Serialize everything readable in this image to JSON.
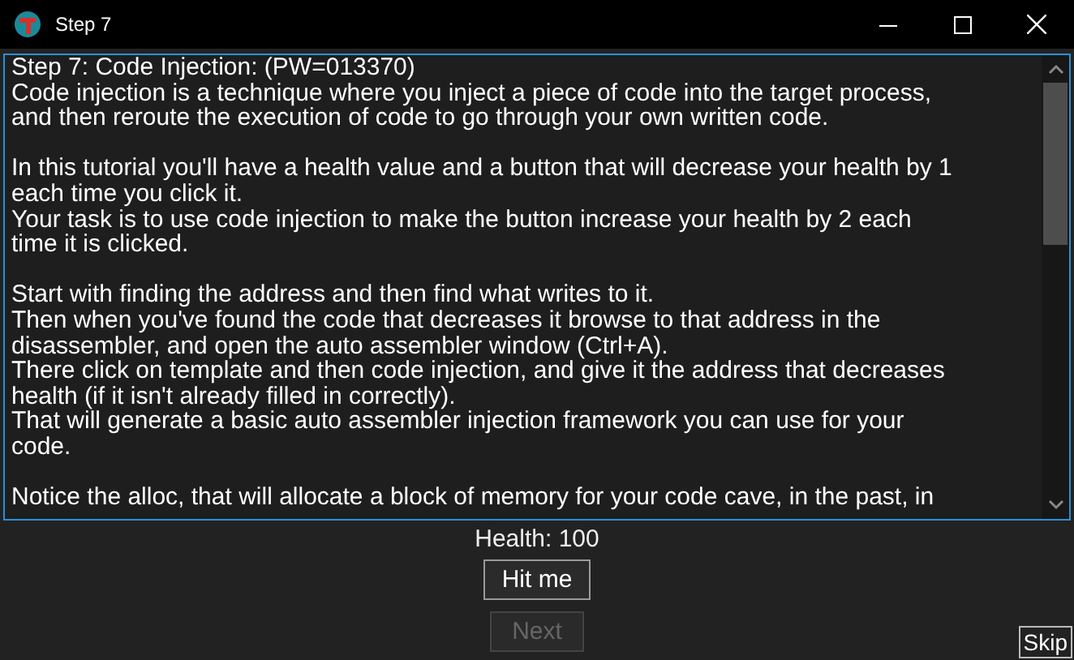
{
  "window": {
    "title": "Step 7"
  },
  "instructions": {
    "paragraphs": [
      [
        "Step 7: Code Injection: (PW=013370)",
        "Code injection is a technique where you inject a piece of code into the target process,",
        "and then reroute the execution of code to go through your own written code."
      ],
      [
        "In this tutorial you'll have a health value and a button that will decrease your health by 1",
        "each time you click it.",
        "Your task is to use code injection to make the button increase your health by 2 each",
        "time it is clicked."
      ],
      [
        "Start with finding the address and then find what writes to it.",
        "Then when you've found the code that decreases it browse to that address in the",
        "disassembler, and open the auto assembler window (Ctrl+A).",
        "There click on template and then code injection, and give it the address that decreases",
        "health (if it isn't already filled in correctly).",
        "That will generate a basic auto assembler injection framework you can use for your",
        "code."
      ],
      [
        "Notice the alloc, that will allocate a block of memory for your code cave, in the past, in"
      ]
    ]
  },
  "health": "Health: 100",
  "buttons": [
    {
      "label": "Hit me",
      "disabled": false
    },
    {
      "label": "Next",
      "disabled": true
    }
  ],
  "skip": "Skip"
}
